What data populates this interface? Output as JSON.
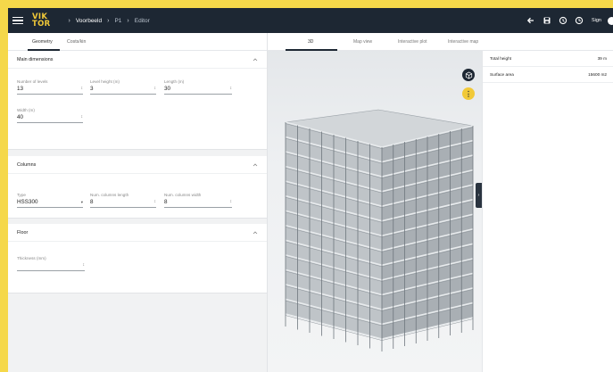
{
  "header": {
    "logo_line1": "VIK",
    "logo_line2": "TOR",
    "breadcrumbs": [
      "Voorbeeld",
      "P1",
      "Editor"
    ],
    "signin_label": "Sign"
  },
  "left_tabs": [
    "Geometry",
    "Costs/kin"
  ],
  "sections": {
    "main": {
      "title": "Main dimensions",
      "fields": [
        {
          "label": "Number of levels",
          "value": "13"
        },
        {
          "label": "Level height (m)",
          "value": "3"
        },
        {
          "label": "Length (m)",
          "value": "30"
        },
        {
          "label": "Width (m)",
          "value": "40"
        }
      ]
    },
    "columns": {
      "title": "Columns",
      "fields": [
        {
          "label": "Type",
          "value": "HSS300"
        },
        {
          "label": "Num. columns length",
          "value": "8"
        },
        {
          "label": "Num. columns width",
          "value": "8"
        }
      ]
    },
    "floor": {
      "title": "Floor",
      "fields": [
        {
          "label": "Thickness (mm)",
          "value": ""
        }
      ]
    }
  },
  "view_tabs": [
    "3D",
    "Map view",
    "Interactive plot",
    "Interactive map"
  ],
  "results": [
    {
      "key": "Total height",
      "value": "39 m"
    },
    {
      "key": "Surface area",
      "value": "15600 m2"
    }
  ],
  "colors": {
    "topbar": "#1d2733",
    "accent": "#f1c938",
    "background": "#f5d84a"
  },
  "icons": [
    "menu-icon",
    "arrow-left-icon",
    "save-icon",
    "history-icon",
    "clock-icon",
    "cube-icon",
    "info-icon",
    "chevron-right-icon"
  ]
}
